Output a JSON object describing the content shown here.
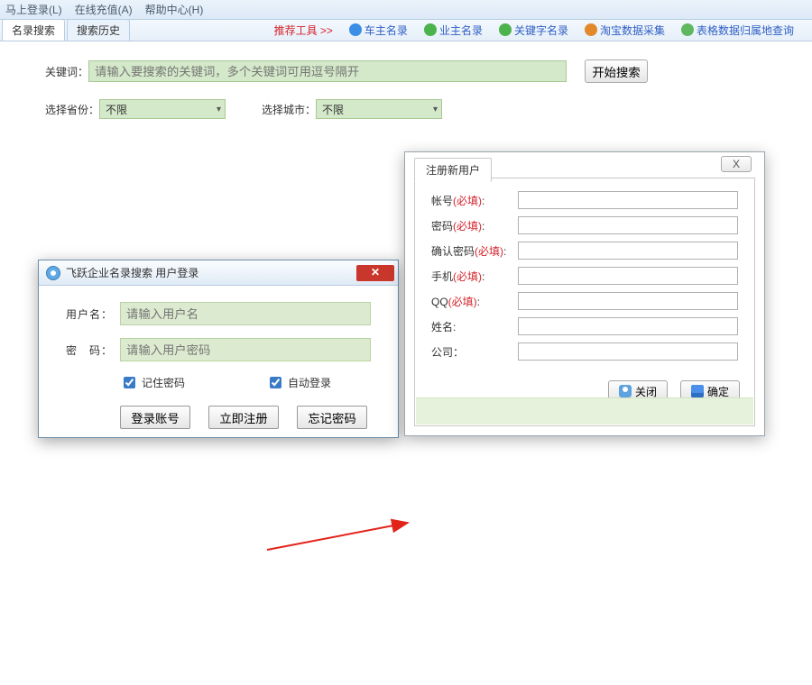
{
  "menu": {
    "login": "马上登录(L)",
    "recharge": "在线充值(A)",
    "help": "帮助中心(H)"
  },
  "tabs": {
    "t1": "名录搜索",
    "t2": "搜索历史"
  },
  "tools": {
    "reco": "推荐工具 >>",
    "carOwner": "车主名录",
    "houseOwner": "业主名录",
    "keyword": "关键字名录",
    "taobao": "淘宝数据采集",
    "attribution": "表格数据归属地查询"
  },
  "search": {
    "kwLabel": "关键词：",
    "kwPlaceholder": "请输入要搜索的关键词，多个关键词可用逗号隔开",
    "btn": "开始搜索",
    "provLabel": "选择省份：",
    "provVal": "不限",
    "cityLabel": "选择城市：",
    "cityVal": "不限"
  },
  "login": {
    "title": "飞跃企业名录搜索 用户登录",
    "userLabel": "用户名：",
    "userPh": "请输入用户名",
    "pwdLabel": "密　码：",
    "pwdPh": "请输入用户密码",
    "remember": "记住密码",
    "auto": "自动登录",
    "btnLogin": "登录账号",
    "btnReg": "立即注册",
    "btnForgot": "忘记密码"
  },
  "reg": {
    "title": "注册新用户",
    "account": "帐号",
    "required": "(必填)",
    "colon": ":",
    "pwd": "密码",
    "confirm": "确认密码",
    "phone": "手机",
    "qq": "QQ",
    "name": "姓名:",
    "company": "公司：",
    "close": "关闭",
    "ok": "确定",
    "x": "X"
  }
}
